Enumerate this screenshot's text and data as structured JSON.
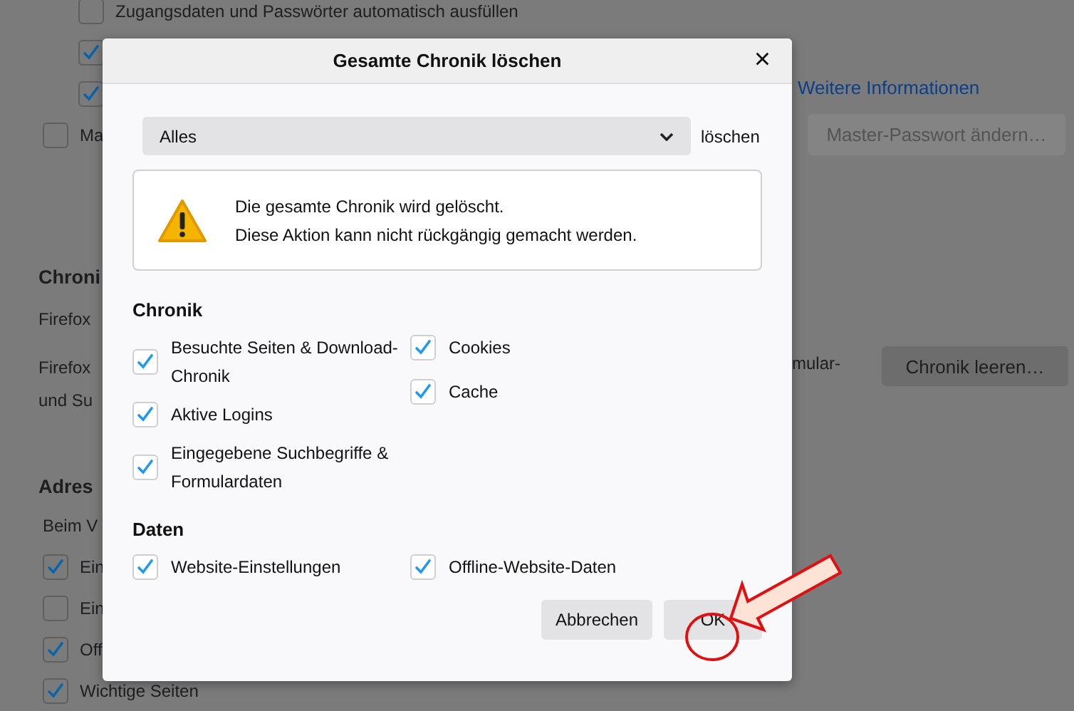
{
  "background_page": {
    "sub_options": [
      {
        "label": "Zugangsdaten und Passwörter automatisch ausfüllen",
        "checked": false
      },
      {
        "checked": true
      },
      {
        "checked": true
      }
    ],
    "master_password_checkbox": {
      "label": "Ma",
      "checked": false
    },
    "more_info_link": "Weitere Informationen",
    "master_password_button": "Master-Passwort ändern…",
    "history_section": {
      "heading": "Chroni",
      "line": "Firefox",
      "paragraph_lines": [
        "Firefox",
        "und Su"
      ],
      "paragraph_right": "mular-",
      "button": "Chronik leeren…"
    },
    "address_section": {
      "heading": "Adres",
      "line": "Beim V",
      "options": [
        {
          "label": "Ein",
          "checked": true
        },
        {
          "label": "Ein",
          "checked": false
        },
        {
          "label": "Off",
          "checked": true
        },
        {
          "label": "Wichtige Seiten",
          "checked": true
        }
      ]
    }
  },
  "dialog": {
    "title": "Gesamte Chronik löschen",
    "close": "×",
    "range": {
      "value": "Alles",
      "label": "löschen"
    },
    "warning": [
      "Die gesamte Chronik wird gelöscht.",
      "Diese Aktion kann nicht rückgängig gemacht werden."
    ],
    "sections": [
      {
        "heading": "Chronik",
        "columns": [
          [
            {
              "label": "Besuchte Seiten & Download-Chronik",
              "checked": true
            },
            {
              "label": "Aktive Logins",
              "checked": true
            },
            {
              "label": "Eingegebene Suchbegriffe & Formulardaten",
              "checked": true
            }
          ],
          [
            {
              "label": "Cookies",
              "checked": true
            },
            {
              "label": "Cache",
              "checked": true
            }
          ]
        ]
      },
      {
        "heading": "Daten",
        "columns": [
          [
            {
              "label": "Website-Einstellungen",
              "checked": true
            }
          ],
          [
            {
              "label": "Offline-Website-Daten",
              "checked": true
            }
          ]
        ]
      }
    ],
    "buttons": [
      {
        "label": "Abbrechen",
        "kind": "cancel"
      },
      {
        "label": "OK",
        "kind": "accept"
      }
    ]
  }
}
